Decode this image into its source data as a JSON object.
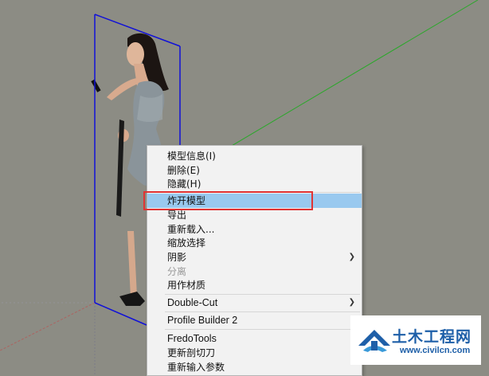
{
  "colors": {
    "viewport_bg": "#8c8c84",
    "bbox_blue": "#1010d8",
    "axis_green": "#2aa82a",
    "axis_red": "#c24a4a",
    "menu_bg": "#f2f2f2",
    "menu_highlight": "#99c9ef",
    "annotation_red": "#e03434",
    "watermark_blue": "#1e5fa8"
  },
  "scene": {
    "model": "2D woman cutout component selected with blue bounding box"
  },
  "context_menu": {
    "groups": [
      [
        {
          "label": "模型信息(I)",
          "disabled": false
        },
        {
          "label": "删除(E)",
          "disabled": false
        },
        {
          "label": "隐藏(H)",
          "disabled": false
        }
      ],
      [
        {
          "label": "炸开模型",
          "disabled": false,
          "highlighted": true
        },
        {
          "label": "导出",
          "disabled": false
        },
        {
          "label": "重新载入...",
          "disabled": false
        },
        {
          "label": "缩放选择",
          "disabled": false
        },
        {
          "label": "阴影",
          "disabled": false,
          "submenu": true
        },
        {
          "label": "分离",
          "disabled": true
        },
        {
          "label": "用作材质",
          "disabled": false
        }
      ],
      [
        {
          "label": "Double-Cut",
          "disabled": false,
          "submenu": true
        }
      ],
      [
        {
          "label": "Profile Builder 2",
          "disabled": false
        }
      ],
      [
        {
          "label": "FredoTools",
          "disabled": false
        },
        {
          "label": "更新剖切刀",
          "disabled": false
        },
        {
          "label": "重新输入参数",
          "disabled": false
        }
      ]
    ],
    "submenu_icon": "chevron-right-icon"
  },
  "watermark": {
    "name": "土木工程网",
    "url": "www.civilcn.com",
    "icon": "civilcn-logo-icon"
  }
}
